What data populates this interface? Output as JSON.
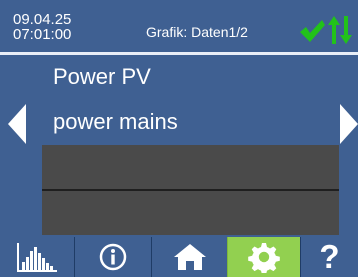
{
  "header": {
    "date": "09.04.25",
    "time": "07:01:00",
    "title": "Grafik: Daten1/2"
  },
  "content": {
    "rows": [
      {
        "label": "Power PV"
      },
      {
        "label": "power mains"
      }
    ]
  },
  "toolbar": {
    "help_label": "?"
  },
  "colors": {
    "panel": "#3f6092",
    "active_tool": "#92d050",
    "status_green": "#22c21a",
    "dark_box": "#4a4a4a"
  },
  "icons": {
    "status": [
      "check-icon",
      "updown-arrows-icon"
    ],
    "navigation": [
      "triangle-left-icon",
      "triangle-right-icon"
    ],
    "tools": [
      "bar-chart-icon",
      "info-icon",
      "home-icon",
      "gear-icon",
      "help-icon"
    ]
  }
}
